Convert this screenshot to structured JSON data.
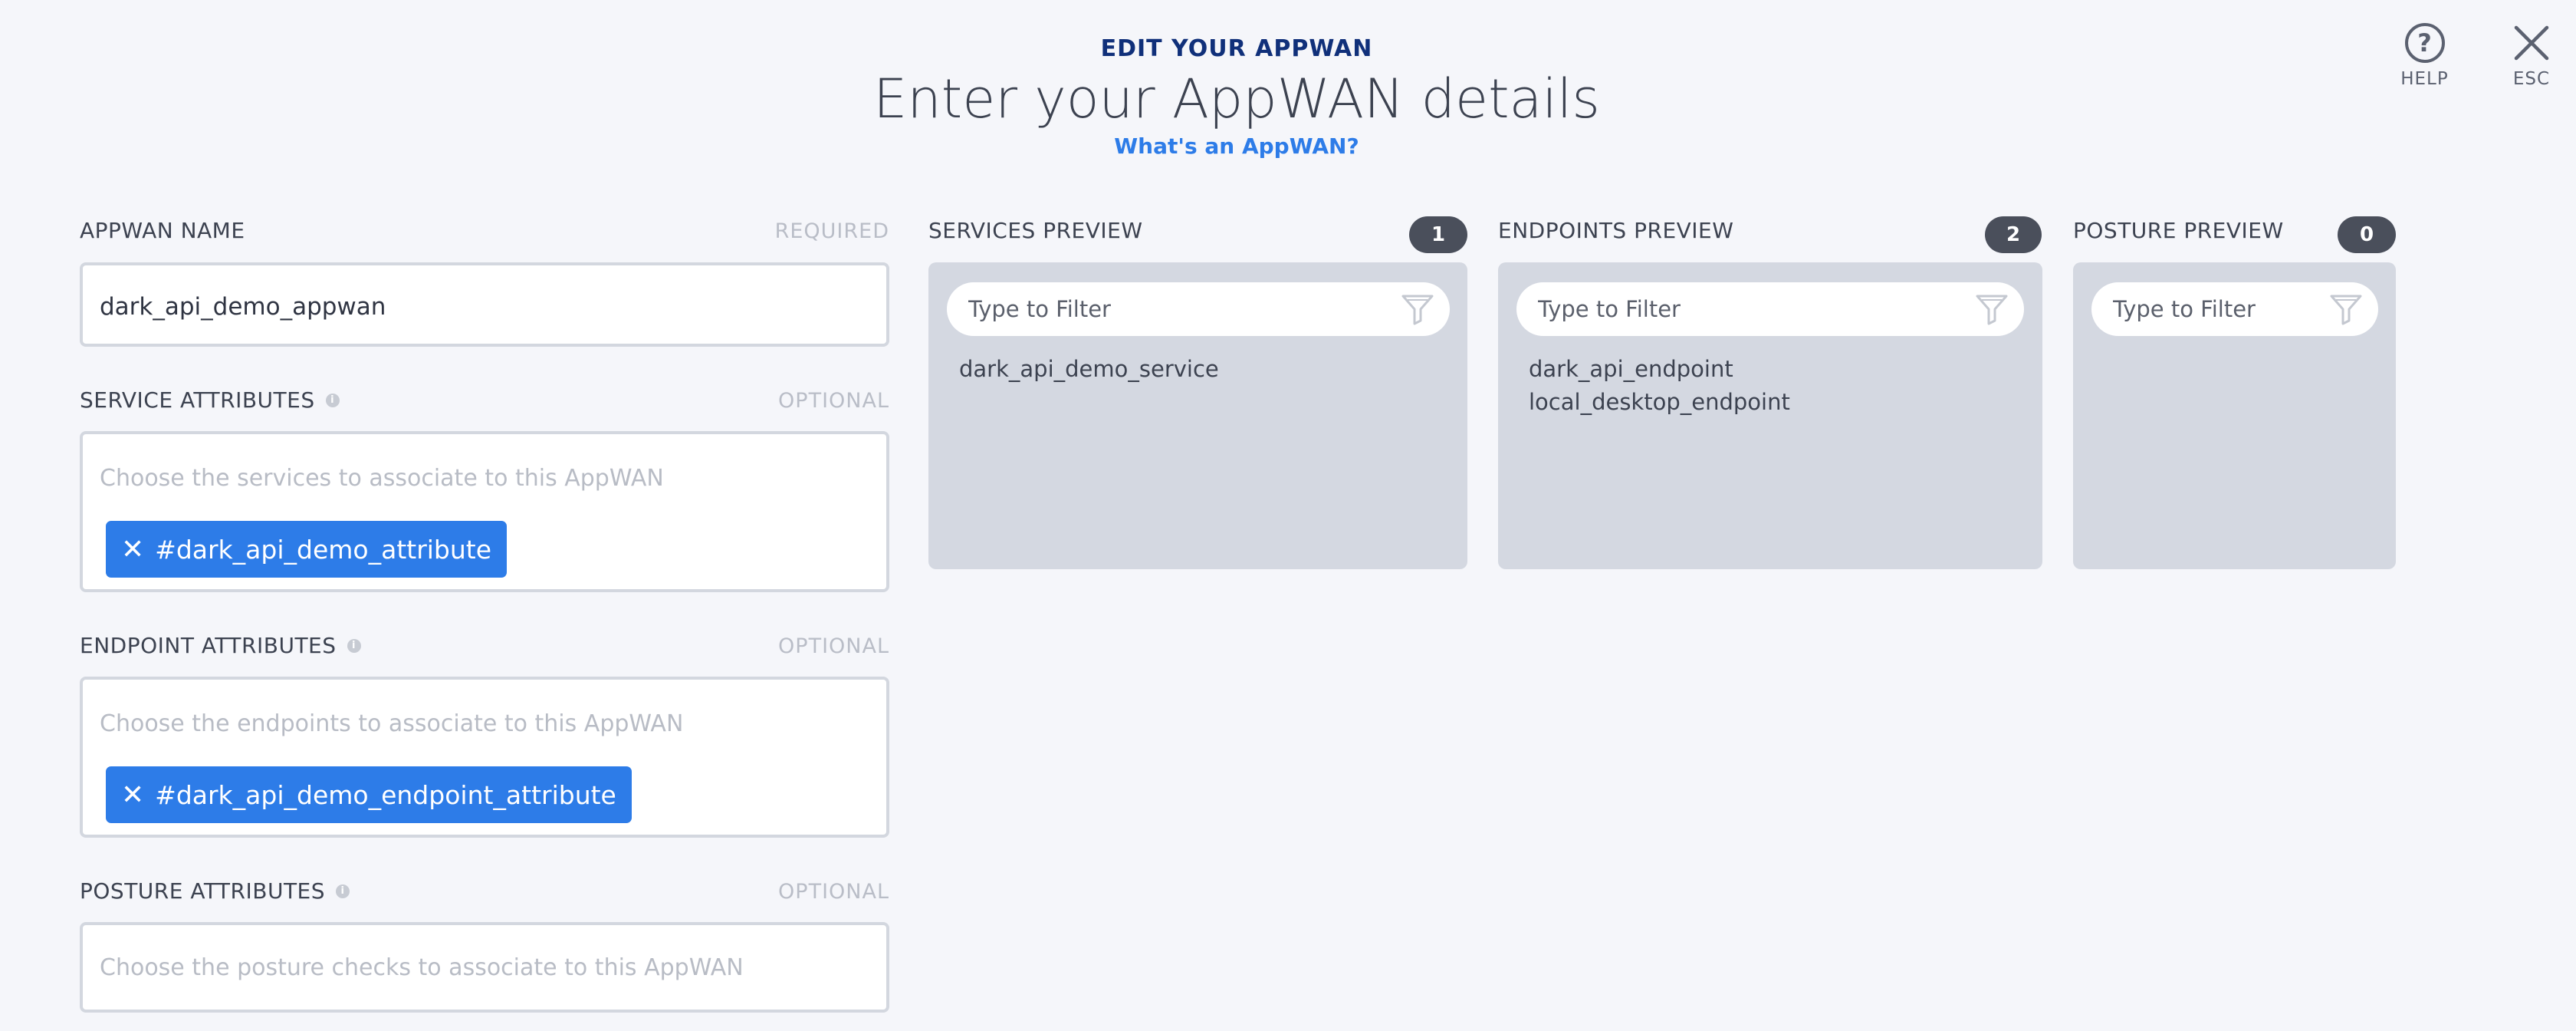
{
  "header": {
    "eyebrow": "EDIT YOUR APPWAN",
    "title": "Enter your AppWAN details",
    "help_link": "What's an AppWAN?"
  },
  "corner": {
    "help_label": "HELP",
    "esc_label": "ESC",
    "help_icon": "question-circle-icon",
    "esc_icon": "close-icon"
  },
  "form": {
    "name": {
      "label": "APPWAN NAME",
      "requirement": "REQUIRED",
      "value": "dark_api_demo_appwan"
    },
    "service_attributes": {
      "label": "SERVICE ATTRIBUTES",
      "requirement": "OPTIONAL",
      "placeholder": "Choose the services to associate to this AppWAN",
      "chips": [
        "#dark_api_demo_attribute"
      ]
    },
    "endpoint_attributes": {
      "label": "ENDPOINT ATTRIBUTES",
      "requirement": "OPTIONAL",
      "placeholder": "Choose the endpoints to associate to this AppWAN",
      "chips": [
        "#dark_api_demo_endpoint_attribute"
      ]
    },
    "posture_attributes": {
      "label": "POSTURE ATTRIBUTES",
      "requirement": "OPTIONAL",
      "placeholder": "Choose the posture checks to associate to this AppWAN"
    }
  },
  "previews": {
    "services": {
      "label": "SERVICES PREVIEW",
      "count": "1",
      "filter_placeholder": "Type to Filter",
      "items": [
        "dark_api_demo_service"
      ]
    },
    "endpoints": {
      "label": "ENDPOINTS PREVIEW",
      "count": "2",
      "filter_placeholder": "Type to Filter",
      "items": [
        "dark_api_endpoint",
        "local_desktop_endpoint"
      ]
    },
    "posture": {
      "label": "POSTURE PREVIEW",
      "count": "0",
      "filter_placeholder": "Type to Filter",
      "items": []
    }
  },
  "colors": {
    "background": "#f5f6fa",
    "accent": "#2d7ce8",
    "eyebrow": "#10307a",
    "panel": "#d4d8e1",
    "badge": "#4a4f5b"
  }
}
